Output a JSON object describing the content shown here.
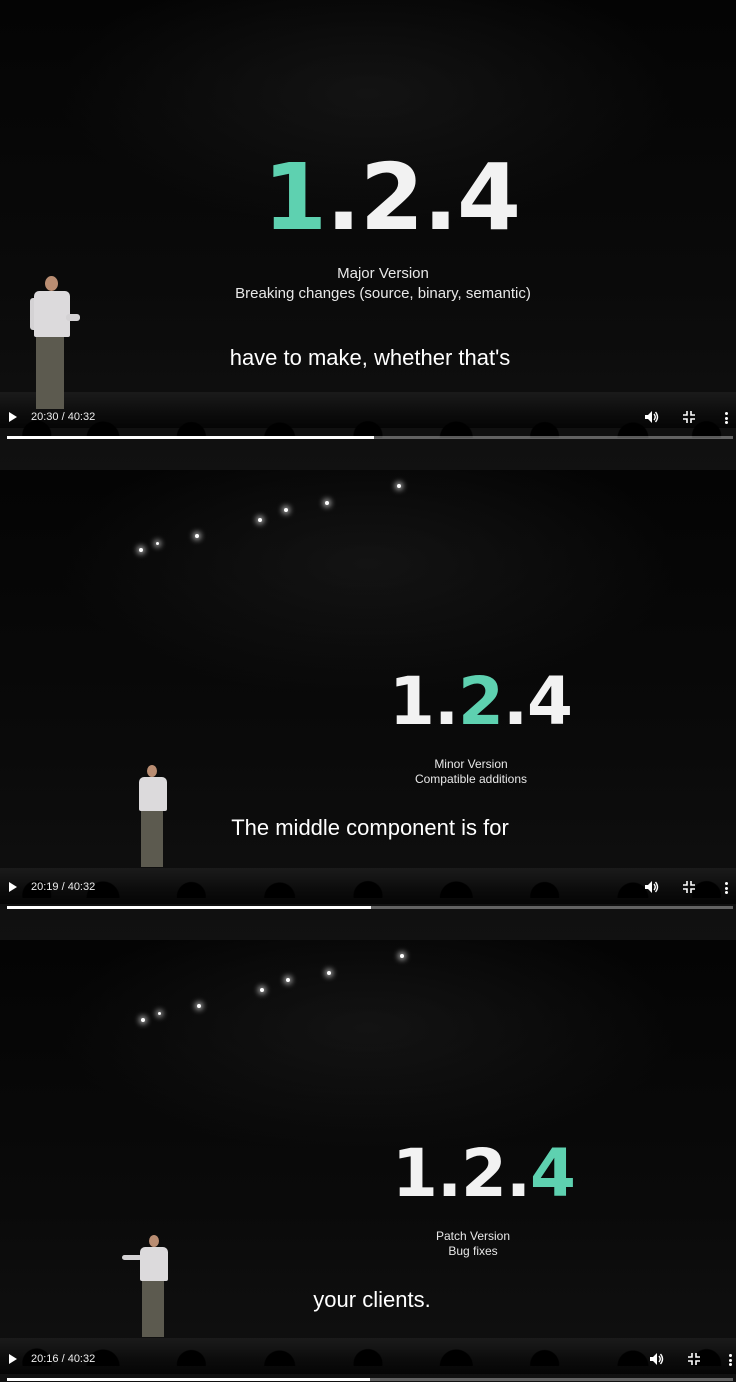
{
  "frames": [
    {
      "version": {
        "major": "1",
        "minor": "2",
        "patch": "4",
        "highlight": "major"
      },
      "caption_line1": "Major Version",
      "caption_line2": "Breaking changes (source, binary, semantic)",
      "subtitle": "have to make, whether that's",
      "time": "20:30 / 40:32",
      "progress_fraction": 0.506
    },
    {
      "version": {
        "major": "1",
        "minor": "2",
        "patch": "4",
        "highlight": "minor"
      },
      "caption_line1": "Minor Version",
      "caption_line2": "Compatible additions",
      "subtitle": "The middle component is for",
      "time": "20:19 / 40:32",
      "progress_fraction": 0.501
    },
    {
      "version": {
        "major": "1",
        "minor": "2",
        "patch": "4",
        "highlight": "patch"
      },
      "caption_line1": "Patch Version",
      "caption_line2": "Bug fixes",
      "subtitle": "your clients.",
      "time": "20:16 / 40:32",
      "progress_fraction": 0.5
    }
  ],
  "icons": {
    "play": "play-icon",
    "volume": "volume-icon",
    "exit_fullscreen": "exit-fullscreen-icon",
    "more": "more-vertical-icon"
  },
  "colors": {
    "accent": "#5ed1b0",
    "slide_text": "#f2f2f2",
    "background": "#000000"
  }
}
